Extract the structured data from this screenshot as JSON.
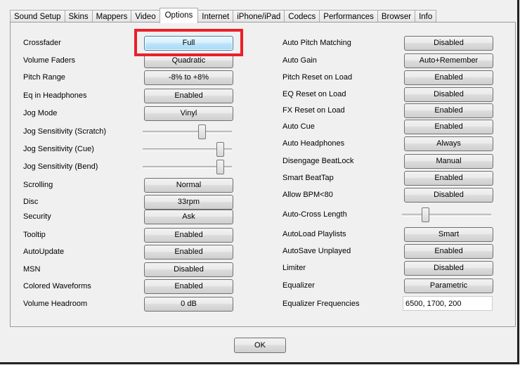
{
  "tabs": [
    "Sound Setup",
    "Skins",
    "Mappers",
    "Video",
    "Options",
    "Internet",
    "iPhone/iPad",
    "Codecs",
    "Performances",
    "Browser",
    "Info"
  ],
  "active_tab": "Options",
  "left": [
    {
      "label": "Crossfader",
      "value": "Full",
      "focus": true
    },
    {
      "label": "Volume Faders",
      "value": "Quadratic"
    },
    {
      "label": "Pitch Range",
      "value": "-8% to +8%"
    },
    {
      "label": "Eq in Headphones",
      "value": "Enabled"
    },
    {
      "label": "Jog Mode",
      "value": "Vinyl"
    },
    {
      "label": "Jog Sensitivity (Scratch)",
      "slider": 0.66
    },
    {
      "label": "Jog Sensitivity (Cue)",
      "slider": 0.87
    },
    {
      "label": "Jog Sensitivity (Bend)",
      "slider": 0.87
    },
    {
      "label": "Scrolling",
      "value": "Normal"
    },
    {
      "label": "Disc",
      "value": "33rpm"
    },
    {
      "label": "Security",
      "value": "Ask"
    },
    {
      "label": "Tooltip",
      "value": "Enabled"
    },
    {
      "label": "AutoUpdate",
      "value": "Enabled"
    },
    {
      "label": "MSN",
      "value": "Disabled"
    },
    {
      "label": "Colored Waveforms",
      "value": "Enabled"
    },
    {
      "label": "Volume Headroom",
      "value": "0 dB"
    }
  ],
  "right": [
    {
      "label": "Auto Pitch Matching",
      "value": "Disabled"
    },
    {
      "label": "Auto Gain",
      "value": "Auto+Remember"
    },
    {
      "label": "Pitch Reset on Load",
      "value": "Enabled"
    },
    {
      "label": "EQ Reset on Load",
      "value": "Disabled"
    },
    {
      "label": "FX Reset on Load",
      "value": "Enabled"
    },
    {
      "label": "Auto Cue",
      "value": "Enabled"
    },
    {
      "label": "Auto Headphones",
      "value": "Always"
    },
    {
      "label": "Disengage BeatLock",
      "value": "Manual"
    },
    {
      "label": "Smart BeatTap",
      "value": "Enabled"
    },
    {
      "label": "Allow BPM<80",
      "value": "Disabled"
    },
    {
      "label": "Auto-Cross Length",
      "slider": 0.26
    },
    {
      "label": "AutoLoad Playlists",
      "value": "Smart"
    },
    {
      "label": "AutoSave Unplayed",
      "value": "Enabled"
    },
    {
      "label": "Limiter",
      "value": "Disabled"
    },
    {
      "label": "Equalizer",
      "value": "Parametric"
    },
    {
      "label": "Equalizer Frequencies",
      "input": "6500, 1700, 200"
    }
  ],
  "ok_label": "OK"
}
